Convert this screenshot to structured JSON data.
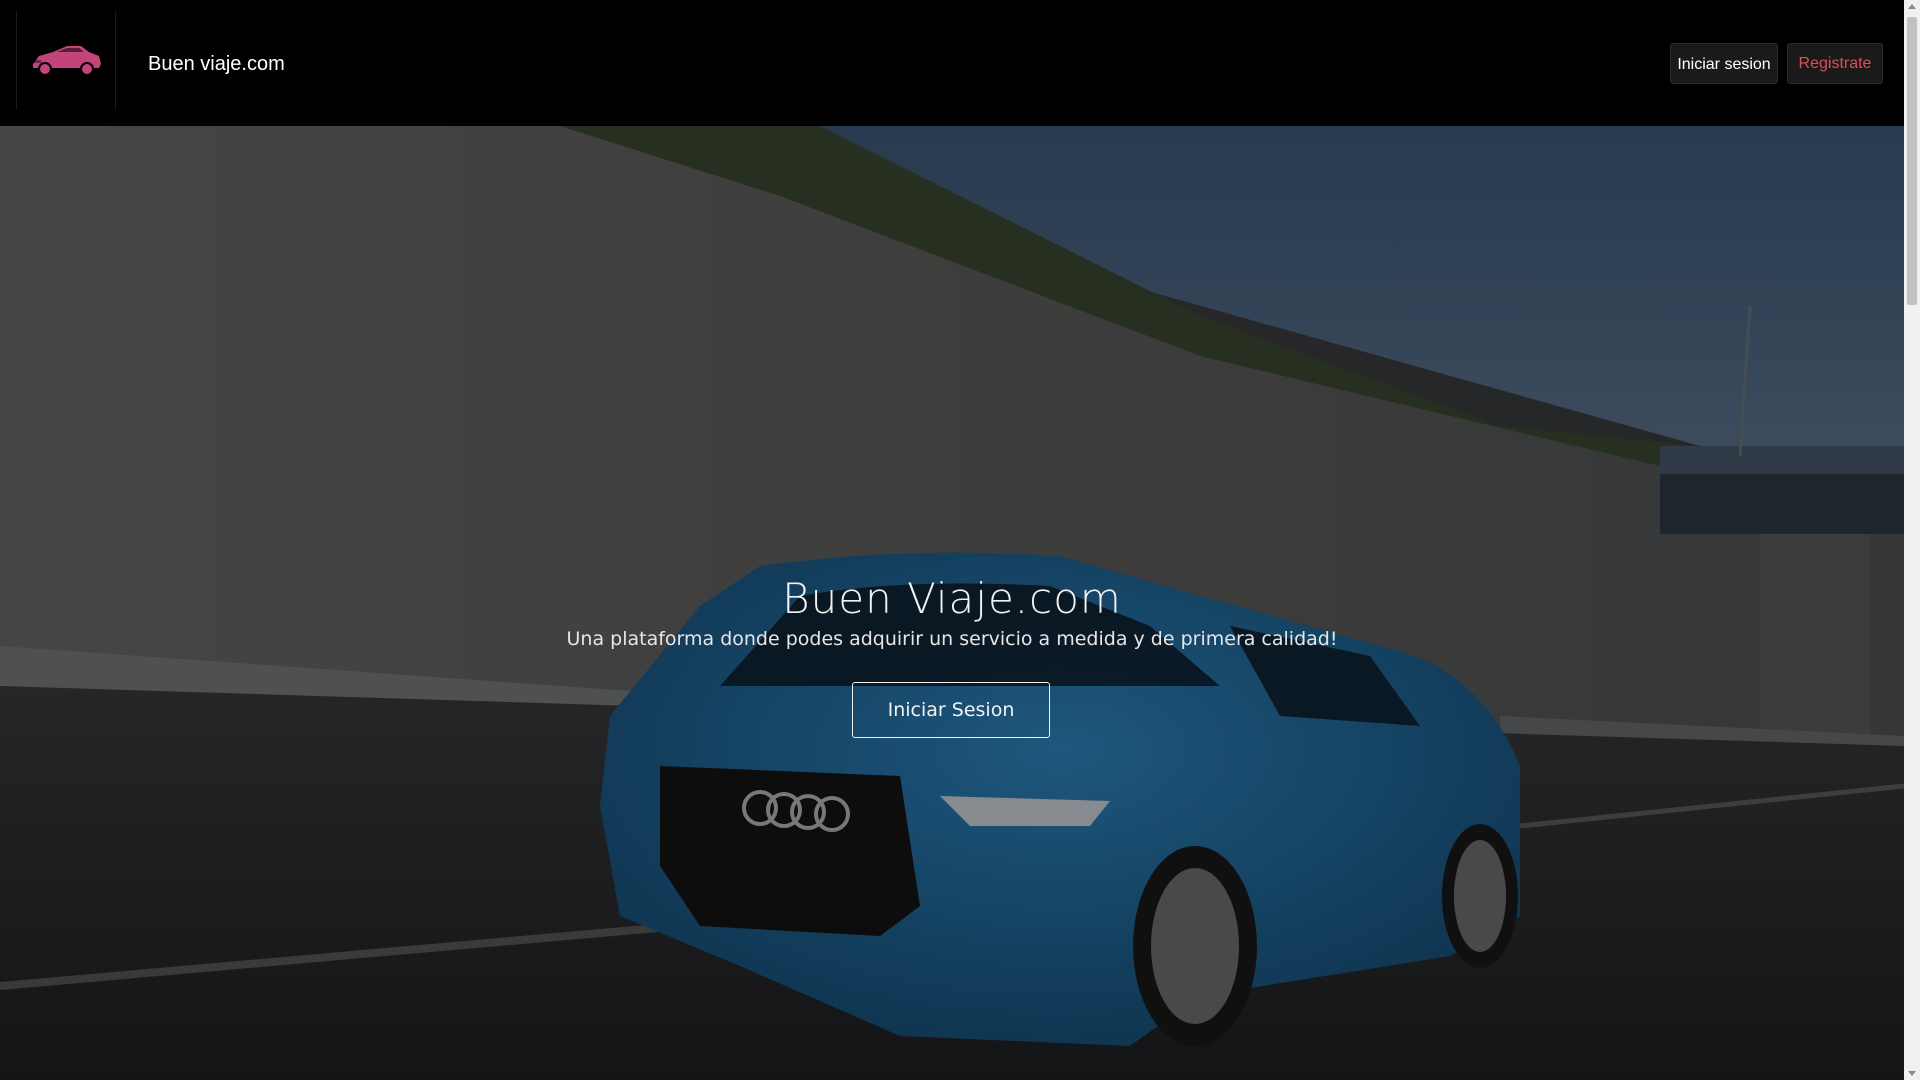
{
  "header": {
    "logo_icon": "car-icon",
    "brand": "Buen viaje.com",
    "login_label": "Iniciar sesion",
    "register_label": "Registrate"
  },
  "hero": {
    "title": "Buen Viaje.com",
    "subtitle": "Una plataforma donde podes adquirir un servicio a medida y de primera calidad!",
    "cta_label": "Iniciar Sesion"
  },
  "colors": {
    "logo": "#c2447a",
    "register_text": "#e14c5a",
    "car_body": "#1f5f93"
  }
}
